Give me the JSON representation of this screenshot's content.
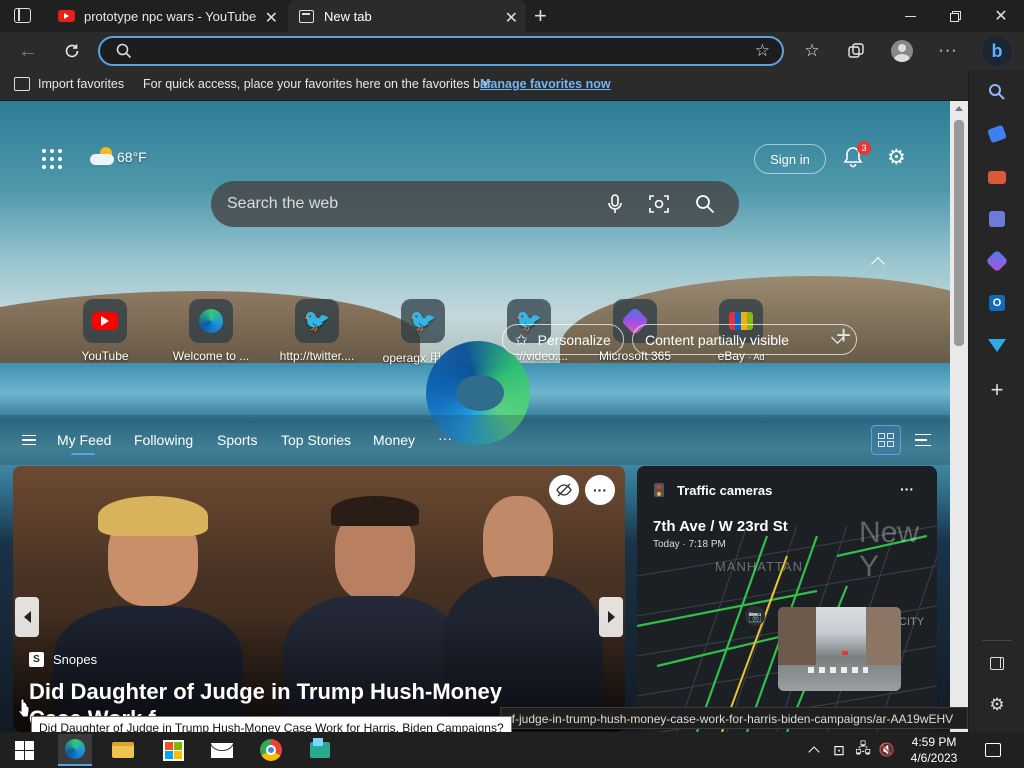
{
  "tabs": [
    {
      "title": "prototype npc wars - YouTube",
      "active": false
    },
    {
      "title": "New tab",
      "active": true
    }
  ],
  "address": {
    "value": "",
    "placeholder": ""
  },
  "favorites_bar": {
    "import_label": "Import favorites",
    "hint": "For quick access, place your favorites here on the favorites bar.",
    "manage_link": "Manage favorites now"
  },
  "new_tab": {
    "weather": "68°F",
    "search_placeholder": "Search the web",
    "sign_in": "Sign in",
    "notification_count": "3",
    "quick_links": [
      {
        "label": "YouTube",
        "icon": "youtube-icon"
      },
      {
        "label": "Welcome to ...",
        "icon": "edge-icon"
      },
      {
        "label": "http://twitter....",
        "icon": "twitter-icon"
      },
      {
        "label": "operagx 用Ｒ...",
        "icon": "twitter-icon"
      },
      {
        "label": "https://video....",
        "icon": "twitter-icon"
      },
      {
        "label": "Microsoft 365",
        "icon": "microsoft365-icon"
      },
      {
        "label": "eBay",
        "icon": "ebay-icon"
      }
    ],
    "ad_tag": "· Ad"
  },
  "feed_nav": {
    "items": [
      "My Feed",
      "Following",
      "Sports",
      "Top Stories",
      "Money"
    ],
    "more": "···",
    "personalize": "Personalize",
    "content_visibility": "Content partially visible"
  },
  "hero_card": {
    "source": "Snopes",
    "headline": "Did Daughter of Judge in Trump Hush-Money",
    "headline_line2": "Case Work f"
  },
  "traffic_card": {
    "title": "Traffic cameras",
    "location": "7th Ave / W 23rd St",
    "time": "Today · 7:18 PM",
    "map_labels": [
      "New Y",
      "MANHATTAN",
      "CITY"
    ]
  },
  "status_url": "of-judge-in-trump-hush-money-case-work-for-harris-biden-campaigns/ar-AA19wEHV",
  "tooltip": "Did Daughter of Judge in Trump Hush-Money Case Work for Harris, Biden Campaigns?",
  "clock": {
    "time": "4:59 PM",
    "date": "4/6/2023"
  },
  "colors": {
    "accent": "#5aa4e6",
    "link": "#74b5f2",
    "tab_active": "#2b2b2b",
    "badge": "#e53935"
  }
}
